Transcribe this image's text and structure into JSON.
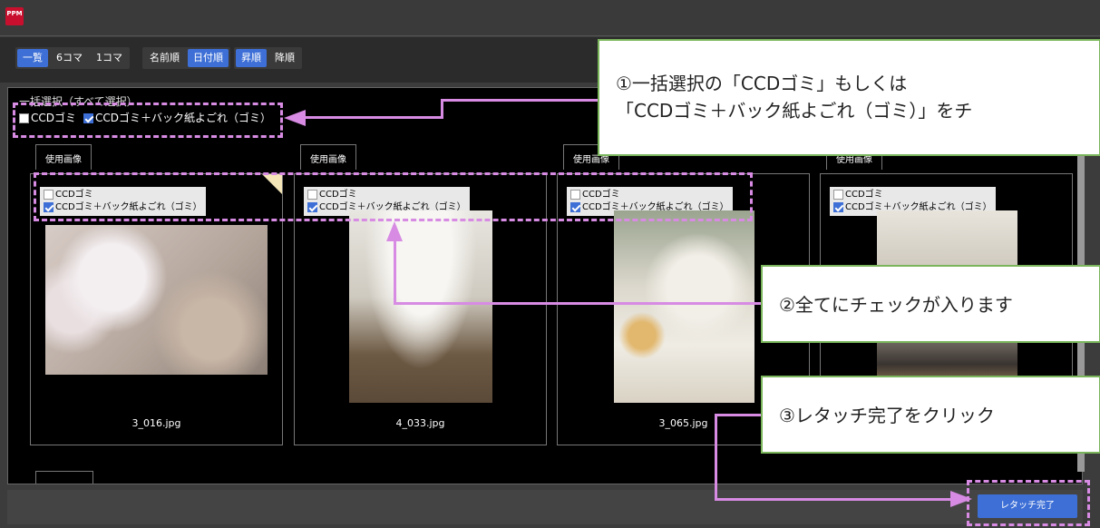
{
  "app": {
    "logo_text": "PPM"
  },
  "toolbar": {
    "view_group": [
      "一覧",
      "6コマ",
      "1コマ"
    ],
    "sort_group": [
      "名前順",
      "日付順"
    ],
    "order_group": [
      "昇順",
      "降順"
    ]
  },
  "bulk": {
    "label": "一括選択（すべて選択）",
    "option1": "CCDゴミ",
    "option1_checked": false,
    "option2": "CCDゴミ＋バック紙よごれ（ゴミ）",
    "option2_checked": true
  },
  "cards": [
    {
      "tab": "使用画像",
      "opt1": "CCDゴミ",
      "opt2": "CCDゴミ＋バック紙よごれ（ゴミ）",
      "filename": "3_016.jpg"
    },
    {
      "tab": "使用画像",
      "opt1": "CCDゴミ",
      "opt2": "CCDゴミ＋バック紙よごれ（ゴミ）",
      "filename": "4_033.jpg"
    },
    {
      "tab": "使用画像",
      "opt1": "CCDゴミ",
      "opt2": "CCDゴミ＋バック紙よごれ（ゴミ）",
      "filename": "3_065.jpg"
    },
    {
      "tab": "使用画像",
      "opt1": "CCDゴミ",
      "opt2": "CCDゴミ＋バック紙よごれ（ゴミ）",
      "filename": ""
    }
  ],
  "footer": {
    "done_button": "レタッチ完了"
  },
  "callouts": {
    "c1_line1": "①一括選択の「CCDゴミ」もしくは",
    "c1_line2": "「CCDゴミ＋バック紙よごれ（ゴミ）」をチ",
    "c2": "②全てにチェックが入ります",
    "c3": "③レタッチ完了をクリック"
  },
  "colors": {
    "accent": "#3d6fd6",
    "annotation": "#d78be3",
    "callout_border": "#7ab55c"
  }
}
